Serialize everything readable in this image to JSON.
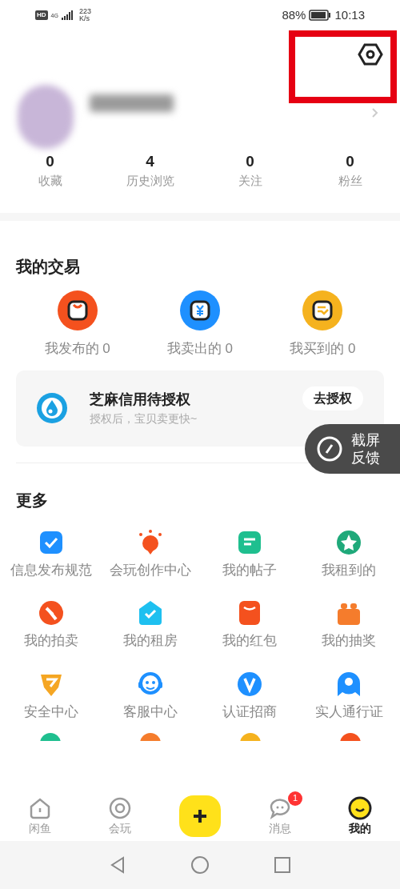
{
  "status_bar": {
    "hd": "HD",
    "network": "4G",
    "speed": "223",
    "speed_unit": "K/s",
    "battery": "88%",
    "time": "10:13"
  },
  "stats": [
    {
      "value": "0",
      "label": "收藏"
    },
    {
      "value": "4",
      "label": "历史浏览"
    },
    {
      "value": "0",
      "label": "关注"
    },
    {
      "value": "0",
      "label": "粉丝"
    }
  ],
  "trade": {
    "title": "我的交易",
    "items": [
      {
        "label": "我发布的 0"
      },
      {
        "label": "我卖出的 0"
      },
      {
        "label": "我买到的 0"
      }
    ]
  },
  "credit_card": {
    "title": "芝麻信用待授权",
    "subtitle": "授权后，宝贝卖更快~",
    "button": "去授权"
  },
  "feedback": {
    "line1": "截屏",
    "line2": "反馈"
  },
  "more": {
    "title": "更多",
    "items": [
      {
        "label": "信息发布规范"
      },
      {
        "label": "会玩创作中心"
      },
      {
        "label": "我的帖子"
      },
      {
        "label": "我租到的"
      },
      {
        "label": "我的拍卖"
      },
      {
        "label": "我的租房"
      },
      {
        "label": "我的红包"
      },
      {
        "label": "我的抽奖"
      },
      {
        "label": "安全中心"
      },
      {
        "label": "客服中心"
      },
      {
        "label": "认证招商"
      },
      {
        "label": "实人通行证"
      }
    ]
  },
  "tabs": [
    {
      "label": "闲鱼",
      "selected": false
    },
    {
      "label": "会玩",
      "selected": false
    },
    {
      "kind": "publish",
      "selected": false
    },
    {
      "label": "消息",
      "selected": false,
      "badge": "1"
    },
    {
      "label": "我的",
      "selected": true
    }
  ]
}
